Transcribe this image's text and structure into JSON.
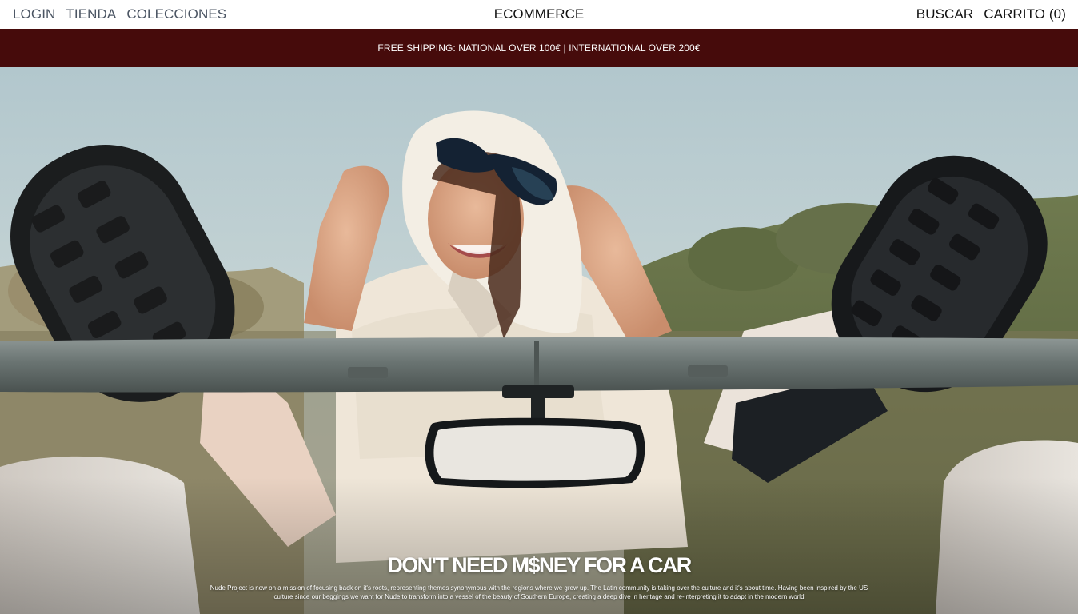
{
  "header": {
    "left_nav": [
      {
        "label": "LOGIN"
      },
      {
        "label": "TIENDA"
      },
      {
        "label": "COLECCIONES"
      }
    ],
    "brand": "ECOMMERCE",
    "right_nav": [
      {
        "label": "BUSCAR"
      },
      {
        "label": "CARRITO (0)"
      }
    ]
  },
  "announcement": {
    "text": "FREE SHIPPING: NATIONAL OVER 100€ | INTERNATIONAL OVER 200€",
    "background": "#460b0b"
  },
  "hero": {
    "headline": "DON'T NEED M$NEY FOR A CAR",
    "body": "Nude Project  is now on a mission of focusing back on it's roots, representing themes synonymous with the regions where we grew up. The Latin community is taking over the culture and it's about time. Having been inspired by the US culture since our beggings we want for Nude to transform into a vessel of the beauty of Southern Europe, creating a deep dive in heritage and re-interpreting it to adapt in the modern world"
  }
}
